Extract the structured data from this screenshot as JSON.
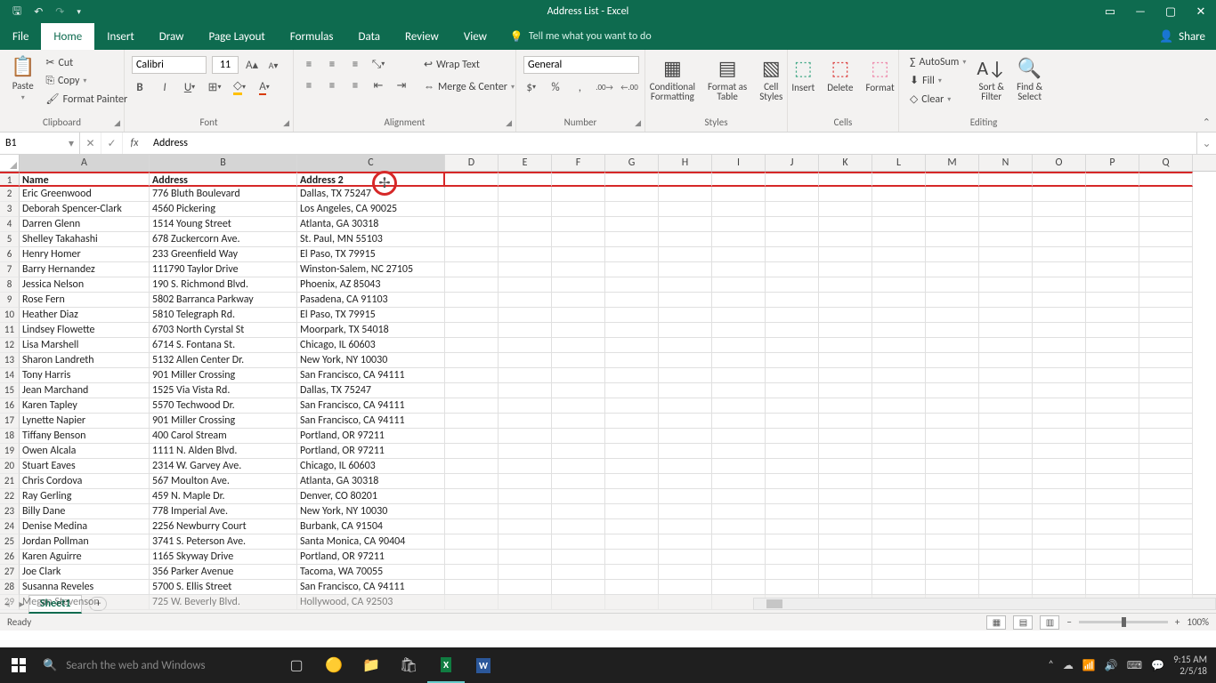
{
  "window": {
    "title": "Address List  -  Excel"
  },
  "share_label": "Share",
  "tabs": [
    "File",
    "Home",
    "Insert",
    "Draw",
    "Page Layout",
    "Formulas",
    "Data",
    "Review",
    "View"
  ],
  "active_tab": "Home",
  "tellme_placeholder": "Tell me what you want to do",
  "ribbon": {
    "clipboard": {
      "paste": "Paste",
      "cut": "Cut",
      "copy": "Copy",
      "format_painter": "Format Painter",
      "label": "Clipboard"
    },
    "font": {
      "name": "Calibri",
      "size": "11",
      "label": "Font"
    },
    "alignment": {
      "wrap": "Wrap Text",
      "merge": "Merge & Center",
      "label": "Alignment"
    },
    "number": {
      "format": "General",
      "label": "Number"
    },
    "styles": {
      "cond": "Conditional\nFormatting",
      "table": "Format as\nTable",
      "cell": "Cell\nStyles",
      "label": "Styles"
    },
    "cells": {
      "insert": "Insert",
      "delete": "Delete",
      "format": "Format",
      "label": "Cells"
    },
    "editing": {
      "autosum": "AutoSum",
      "fill": "Fill",
      "clear": "Clear",
      "sort": "Sort &\nFilter",
      "find": "Find &\nSelect",
      "label": "Editing"
    }
  },
  "formula_bar": {
    "cell_ref": "B1",
    "value": "Address"
  },
  "columns": [
    "A",
    "B",
    "C",
    "D",
    "E",
    "F",
    "G",
    "H",
    "I",
    "J",
    "K",
    "L",
    "M",
    "N",
    "O",
    "P",
    "Q"
  ],
  "col_widths": {
    "A": 146,
    "B": 166,
    "C": 166,
    "rest": 60
  },
  "selected_cols": [
    "A",
    "B",
    "C"
  ],
  "headers": {
    "A": "Name",
    "B": "Address",
    "C": "Address 2"
  },
  "rows": [
    {
      "n": 2,
      "A": "Eric Greenwood",
      "B": "776 Bluth Boulevard",
      "C": "Dallas, TX 75247"
    },
    {
      "n": 3,
      "A": "Deborah Spencer-Clark",
      "B": "4560 Pickering",
      "C": "Los Angeles, CA 90025"
    },
    {
      "n": 4,
      "A": "Darren Glenn",
      "B": "1514 Young Street",
      "C": "Atlanta, GA 30318"
    },
    {
      "n": 5,
      "A": "Shelley Takahashi",
      "B": "678 Zuckercorn Ave.",
      "C": "St. Paul, MN 55103"
    },
    {
      "n": 6,
      "A": "Henry Homer",
      "B": "233 Greenfield Way",
      "C": "El Paso, TX 79915"
    },
    {
      "n": 7,
      "A": "Barry Hernandez",
      "B": "111790 Taylor Drive",
      "C": "Winston-Salem, NC 27105"
    },
    {
      "n": 8,
      "A": "Jessica Nelson",
      "B": "190 S. Richmond Blvd.",
      "C": "Phoenix, AZ 85043"
    },
    {
      "n": 9,
      "A": "Rose Fern",
      "B": "5802 Barranca Parkway",
      "C": "Pasadena, CA 91103"
    },
    {
      "n": 10,
      "A": "Heather Diaz",
      "B": "5810 Telegraph Rd.",
      "C": "El Paso, TX 79915"
    },
    {
      "n": 11,
      "A": "Lindsey Flowette",
      "B": "6703 North Cyrstal St",
      "C": "Moorpark, TX 54018"
    },
    {
      "n": 12,
      "A": "Lisa Marshell",
      "B": "6714 S. Fontana St.",
      "C": "Chicago, IL 60603"
    },
    {
      "n": 13,
      "A": "Sharon Landreth",
      "B": "5132 Allen Center Dr.",
      "C": "New York, NY 10030"
    },
    {
      "n": 14,
      "A": "Tony Harris",
      "B": "901 Miller Crossing",
      "C": "San Francisco, CA 94111"
    },
    {
      "n": 15,
      "A": "Jean Marchand",
      "B": "1525 Via Vista Rd.",
      "C": "Dallas, TX 75247"
    },
    {
      "n": 16,
      "A": "Karen Tapley",
      "B": "5570 Techwood Dr.",
      "C": "San Francisco, CA 94111"
    },
    {
      "n": 17,
      "A": "Lynette Napier",
      "B": "901 Miller Crossing",
      "C": "San Francisco, CA 94111"
    },
    {
      "n": 18,
      "A": "Tiffany Benson",
      "B": "400 Carol Stream",
      "C": "Portland, OR 97211"
    },
    {
      "n": 19,
      "A": "Owen Alcala",
      "B": "1111 N. Alden Blvd.",
      "C": "Portland, OR 97211"
    },
    {
      "n": 20,
      "A": "Stuart Eaves",
      "B": "2314 W. Garvey Ave.",
      "C": "Chicago, IL 60603"
    },
    {
      "n": 21,
      "A": "Chris Cordova",
      "B": "567 Moulton Ave.",
      "C": "Atlanta, GA 30318"
    },
    {
      "n": 22,
      "A": "Ray Gerling",
      "B": "459 N. Maple Dr.",
      "C": "Denver, CO 80201"
    },
    {
      "n": 23,
      "A": "Billy Dane",
      "B": "778 Imperial Ave.",
      "C": "New York, NY 10030"
    },
    {
      "n": 24,
      "A": "Denise Medina",
      "B": "2256 Newburry Court",
      "C": "Burbank, CA 91504"
    },
    {
      "n": 25,
      "A": "Jordan Pollman",
      "B": "3741 S. Peterson Ave.",
      "C": "Santa Monica, CA 90404"
    },
    {
      "n": 26,
      "A": "Karen Aguirre",
      "B": "1165 Skyway Drive",
      "C": "Portland, OR 97211"
    },
    {
      "n": 27,
      "A": "Joe Clark",
      "B": "356 Parker Avenue",
      "C": "Tacoma, WA 70055"
    },
    {
      "n": 28,
      "A": "Susanna Reveles",
      "B": "5700 S. Ellis Street",
      "C": "San Francisco, CA 94111"
    },
    {
      "n": 29,
      "A": "Megan Stevenson",
      "B": "725 W. Beverly Blvd.",
      "C": "Hollywood, CA 92503"
    }
  ],
  "sheet": {
    "name": "Sheet1"
  },
  "status": {
    "ready": "Ready",
    "zoom": "100%"
  },
  "taskbar": {
    "search_placeholder": "Search the web and Windows",
    "time": "9:15 AM",
    "date": "2/5/18"
  }
}
